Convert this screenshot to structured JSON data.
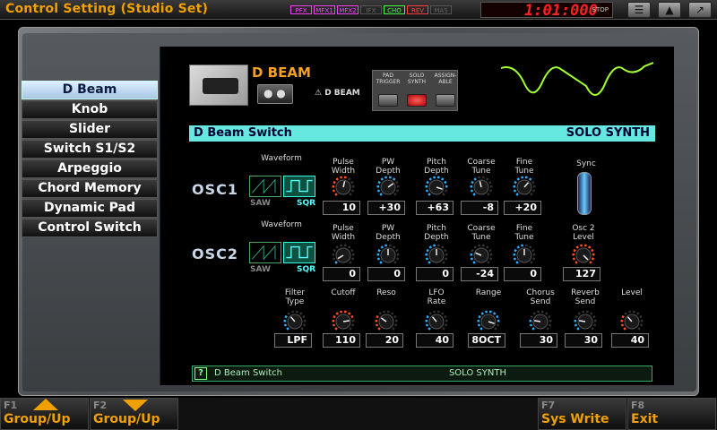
{
  "title": "Control Setting (Studio Set)",
  "fx_indicators": [
    {
      "label": "PFX",
      "color": "#ff40ff",
      "on": true
    },
    {
      "label": "MFX1",
      "color": "#ff40ff",
      "on": true
    },
    {
      "label": "MFX2",
      "color": "#ff40ff",
      "on": true
    },
    {
      "label": "IFX",
      "color": "#777777",
      "on": false
    },
    {
      "label": "CHO",
      "color": "#40ff40",
      "on": true
    },
    {
      "label": "REV",
      "color": "#ff4040",
      "on": true
    },
    {
      "label": "MAS",
      "color": "#777777",
      "on": false
    }
  ],
  "transport": {
    "time": "1:01:000",
    "state": "STOP"
  },
  "sidebar": {
    "items": [
      {
        "label": "D Beam",
        "active": true
      },
      {
        "label": "Knob"
      },
      {
        "label": "Slider"
      },
      {
        "label": "Switch S1/S2"
      },
      {
        "label": "Arpeggio"
      },
      {
        "label": "Chord Memory"
      },
      {
        "label": "Dynamic Pad"
      },
      {
        "label": "Control Switch"
      }
    ]
  },
  "device": {
    "title": "D BEAM",
    "logo_text": "D BEAM",
    "modes": [
      {
        "label": "PAD\nTRIGGER",
        "on": false
      },
      {
        "label": "SOLO\nSYNTH",
        "on": true
      },
      {
        "label": "ASSIGN-\nABLE",
        "on": false
      }
    ]
  },
  "switch_bar": {
    "label": "D Beam Switch",
    "value": "SOLO SYNTH"
  },
  "osc1": {
    "name": "OSC1",
    "waveform_label": "Waveform",
    "waveforms": [
      "SAW",
      "SQR"
    ],
    "selected": "SQR",
    "params": [
      {
        "label": "Pulse\nWidth",
        "value": "10"
      },
      {
        "label": "PW\nDepth",
        "value": "+30"
      },
      {
        "label": "Pitch\nDepth",
        "value": "+63"
      },
      {
        "label": "Coarse\nTune",
        "value": "-8"
      },
      {
        "label": "Fine\nTune",
        "value": "+20"
      }
    ],
    "sync_label": "Sync"
  },
  "osc2": {
    "name": "OSC2",
    "waveform_label": "Waveform",
    "waveforms": [
      "SAW",
      "SQR"
    ],
    "selected": "SQR",
    "params": [
      {
        "label": "Pulse\nWidth",
        "value": "0"
      },
      {
        "label": "PW\nDepth",
        "value": "0"
      },
      {
        "label": "Pitch\nDepth",
        "value": "0"
      },
      {
        "label": "Coarse\nTune",
        "value": "-24"
      },
      {
        "label": "Fine\nTune",
        "value": "0"
      },
      {
        "label": "Osc 2\nLevel",
        "value": "127"
      }
    ]
  },
  "filter_row": [
    {
      "label": "Filter\nType",
      "value": "LPF"
    },
    {
      "label": "Cutoff",
      "value": "110"
    },
    {
      "label": "Reso",
      "value": "20"
    },
    {
      "label": "LFO\nRate",
      "value": "40"
    },
    {
      "label": "Range",
      "value": "8OCT"
    },
    {
      "label": "Chorus\nSend",
      "value": "30"
    },
    {
      "label": "Reverb\nSend",
      "value": "30"
    },
    {
      "label": "Level",
      "value": "40"
    }
  ],
  "info": {
    "label": "D Beam Switch",
    "value": "SOLO SYNTH"
  },
  "fkeys": [
    {
      "num": "F1",
      "label": "Group/Up"
    },
    {
      "num": "F2",
      "label": "Group/Up"
    },
    {
      "num": "F7",
      "label": "Sys Write"
    },
    {
      "num": "F8",
      "label": "Exit"
    }
  ],
  "colors": {
    "accent": "#f0a000",
    "cyan": "#66e8e0",
    "knob_arc": "#2ab0ff",
    "knob_arc_red": "#ff5020"
  }
}
